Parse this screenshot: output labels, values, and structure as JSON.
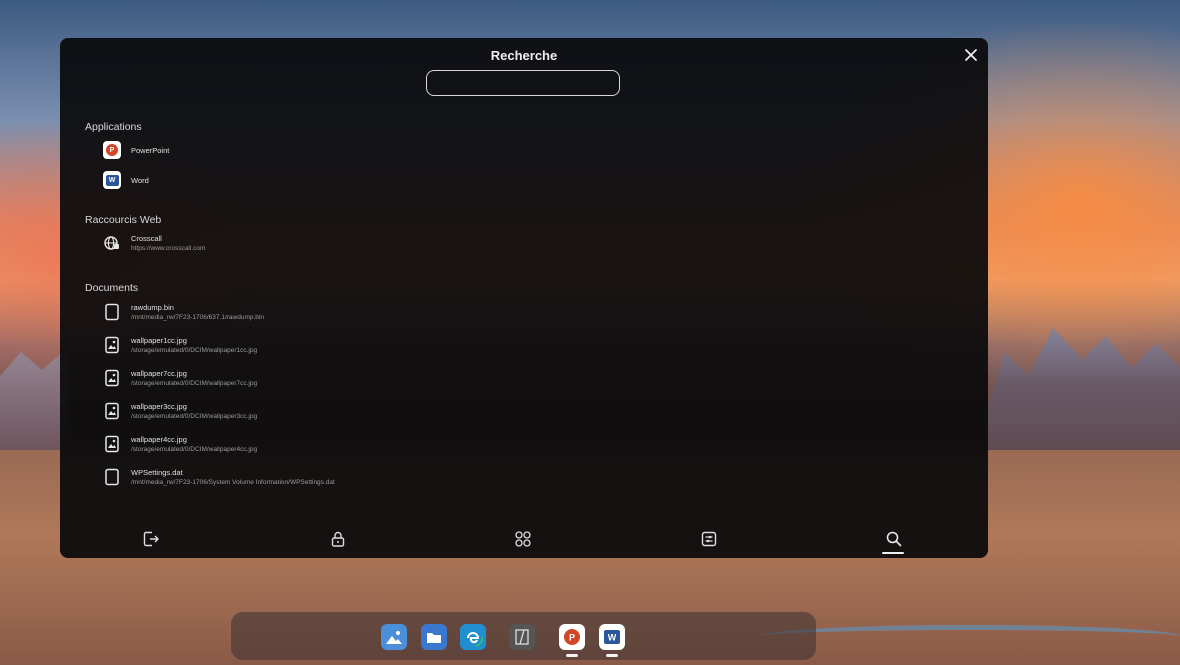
{
  "panel": {
    "title": "Recherche",
    "search": {
      "value": "",
      "placeholder": ""
    },
    "close_icon": "close-icon"
  },
  "sections": {
    "applications": {
      "title": "Applications",
      "items": [
        {
          "label": "PowerPoint",
          "icon": "powerpoint-icon"
        },
        {
          "label": "Word",
          "icon": "word-icon"
        }
      ]
    },
    "web": {
      "title": "Raccourcis Web",
      "items": [
        {
          "label": "Crosscall",
          "url": "https://www.crosscall.com",
          "icon": "globe-icon"
        }
      ]
    },
    "documents": {
      "title": "Documents",
      "items": [
        {
          "name": "rawdump.bin",
          "path": "/mnt/media_rw/7F23-1706/637.1/rawdump.bin",
          "icon": "file-icon"
        },
        {
          "name": "wallpaper1cc.jpg",
          "path": "/storage/emulated/0/DCIM/wallpaper1cc.jpg",
          "icon": "image-icon"
        },
        {
          "name": "wallpaper7cc.jpg",
          "path": "/storage/emulated/0/DCIM/wallpaper7cc.jpg",
          "icon": "image-icon"
        },
        {
          "name": "wallpaper3cc.jpg",
          "path": "/storage/emulated/0/DCIM/wallpaper3cc.jpg",
          "icon": "image-icon"
        },
        {
          "name": "wallpaper4cc.jpg",
          "path": "/storage/emulated/0/DCIM/wallpaper4cc.jpg",
          "icon": "image-icon"
        },
        {
          "name": "WPSettings.dat",
          "path": "/mnt/media_rw/7F23-1706/System Volume Information/WPSettings.dat",
          "icon": "file-icon"
        }
      ]
    }
  },
  "tabbar": [
    {
      "icon": "exit-icon"
    },
    {
      "icon": "lock-icon"
    },
    {
      "icon": "apps-grid-icon"
    },
    {
      "icon": "settings-panel-icon"
    },
    {
      "icon": "search-icon",
      "active": true
    }
  ],
  "dock": [
    {
      "icon": "gallery-icon",
      "color": "#4a8fd8"
    },
    {
      "icon": "folder-icon",
      "color": "#3a78d0"
    },
    {
      "icon": "edge-icon",
      "color": "#1f8fd0"
    },
    {
      "icon": "mirror-icon",
      "color": "#666666"
    },
    {
      "icon": "powerpoint-icon",
      "color": "#d24726",
      "running": true
    },
    {
      "icon": "word-icon",
      "color": "#2b579a",
      "running": true
    }
  ]
}
